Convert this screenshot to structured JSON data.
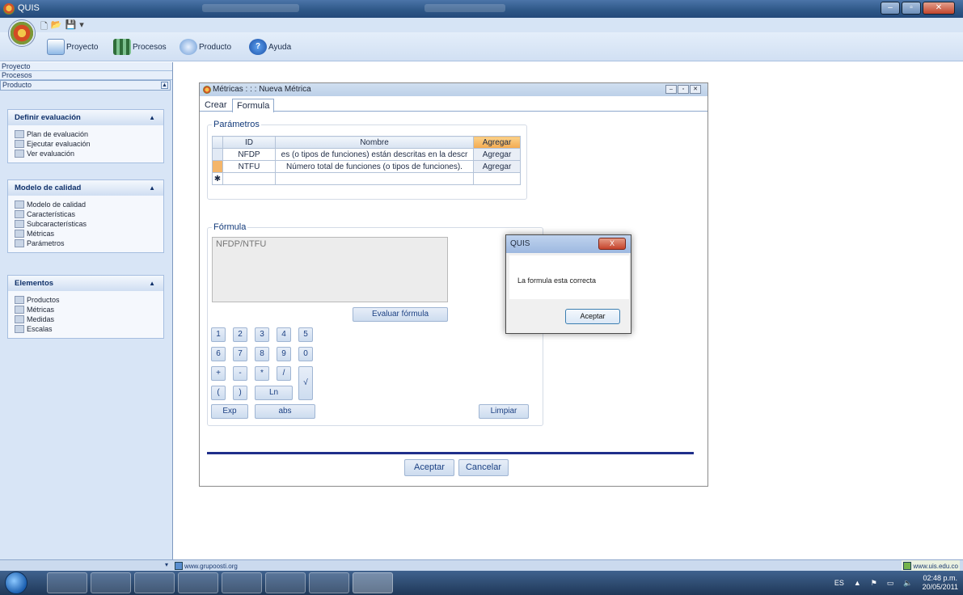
{
  "app": {
    "title": "QUIS"
  },
  "ribbon": {
    "items": [
      {
        "label": "Proyecto",
        "icon": "proyecto-icon"
      },
      {
        "label": "Procesos",
        "icon": "procesos-icon"
      },
      {
        "label": "Producto",
        "icon": "producto-icon"
      },
      {
        "label": "Ayuda",
        "icon": "help-icon"
      }
    ]
  },
  "leftpanel": {
    "categories": [
      "Proyecto",
      "Procesos",
      "Producto"
    ],
    "groups": [
      {
        "title": "Definir evaluación",
        "items": [
          "Plan de evaluación",
          "Ejecutar evaluación",
          "Ver evaluación"
        ]
      },
      {
        "title": "Modelo de calidad",
        "items": [
          "Modelo de calidad",
          "Características",
          "Subcaracterísticas",
          "Métricas",
          "Parámetros"
        ]
      },
      {
        "title": "Elementos",
        "items": [
          "Productos",
          "Métricas",
          "Medidas",
          "Escalas"
        ]
      }
    ]
  },
  "window": {
    "title": "Métricas : : : Nueva Métrica",
    "tabs": [
      "Crear",
      "Formula"
    ],
    "parametros_label": "Parámetros",
    "grid": {
      "headers": [
        "ID",
        "Nombre",
        "Agregar"
      ],
      "rows": [
        {
          "id": "NFDP",
          "nombre": "es (o tipos de funciones) están descritas en la descr",
          "agregar": "Agregar"
        },
        {
          "id": "NTFU",
          "nombre": "Número total de funciones (o tipos de funciones).",
          "agregar": "Agregar"
        }
      ],
      "new_row_marker": "✱"
    },
    "formula_label": "Fórmula",
    "formula_value": "NFDP/NTFU",
    "evaluar": "Evaluar fórmula",
    "keys_row1": [
      "1",
      "2",
      "3",
      "4",
      "5"
    ],
    "keys_row2": [
      "6",
      "7",
      "8",
      "9",
      "0"
    ],
    "keys_row3": [
      "+",
      "-",
      "*",
      "/"
    ],
    "key_sqrt": "√",
    "keys_row4": [
      "(",
      ")"
    ],
    "key_ln": "Ln",
    "key_exp": "Exp",
    "key_abs": "abs",
    "limpiar": "Limpiar",
    "aceptar": "Aceptar",
    "cancelar": "Cancelar"
  },
  "dialog": {
    "title": "QUIS",
    "message": "La formula esta correcta",
    "button": "Aceptar",
    "close": "X"
  },
  "statusbar": {
    "left_url": "www.grupoosti.org",
    "right_url": "www.uis.edu.co"
  },
  "taskbar": {
    "lang": "ES",
    "time": "02:48 p.m.",
    "date": "20/05/2011"
  }
}
